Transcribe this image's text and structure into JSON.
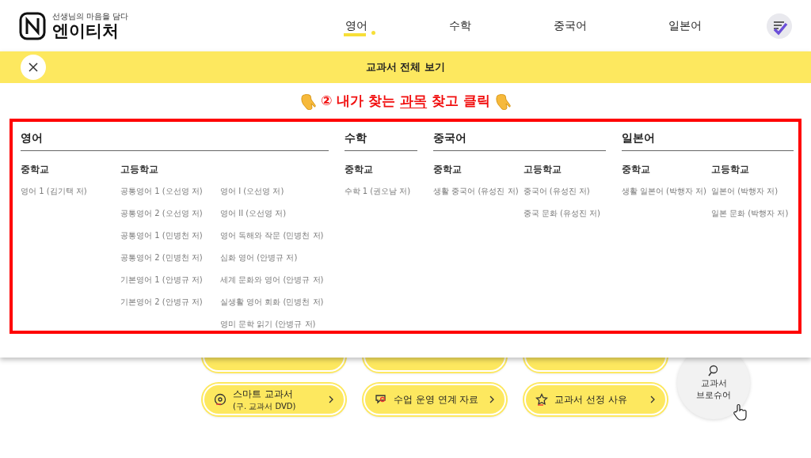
{
  "header": {
    "tagline": "선생님의 마음을 담다",
    "logo": "엔이티처",
    "nav": [
      {
        "label": "영어",
        "selected": true
      },
      {
        "label": "수학",
        "selected": false
      },
      {
        "label": "중국어",
        "selected": false
      },
      {
        "label": "일본어",
        "selected": false
      }
    ]
  },
  "banner": {
    "title": "교과서 전체 보기"
  },
  "instruction": {
    "before": "② 내가 찾는",
    "underlined": "과목",
    "after": "찾고 클릭"
  },
  "subjects": [
    {
      "title": "영어",
      "groups": [
        {
          "heading": "중학교",
          "columns": [
            [
              "영어 1 (김기택 저)"
            ]
          ]
        },
        {
          "heading": "고등학교",
          "columns": [
            [
              "공통영어 1 (오선영 저)",
              "공통영어 2 (오선영 저)",
              "공통영어 1 (민병천 저)",
              "공통영어 2 (민병천 저)",
              "기본영어 1 (안병규 저)",
              "기본영어 2 (안병규 저)"
            ],
            [
              "영어 I (오선영 저)",
              "영어 II (오선영 저)",
              "영어 독해와 작문 (민병천 저)",
              "심화 영어 (안병규 저)",
              "세계 문화와 영어 (안병규 저)",
              "실생활 영어 회화 (민병천 저)",
              "영미 문학 읽기 (안병규 저)"
            ]
          ]
        }
      ]
    },
    {
      "title": "수학",
      "groups": [
        {
          "heading": "중학교",
          "columns": [
            [
              "수학 1 (권오남 저)"
            ]
          ]
        }
      ]
    },
    {
      "title": "중국어",
      "groups": [
        {
          "heading": "중학교",
          "columns": [
            [
              "생활 중국어 (유성진 저)"
            ]
          ]
        },
        {
          "heading": "고등학교",
          "columns": [
            [
              "중국어 (유성진 저)",
              "중국 문화 (유성진 저)"
            ]
          ]
        }
      ]
    },
    {
      "title": "일본어",
      "groups": [
        {
          "heading": "중학교",
          "columns": [
            [
              "생활 일본어 (박행자 저)"
            ]
          ]
        },
        {
          "heading": "고등학교",
          "columns": [
            [
              "일본어 (박행자 저)",
              "일본 문화 (박행자 저)"
            ]
          ]
        }
      ]
    }
  ],
  "quick_links": [
    {
      "label": "스마트 교과서",
      "sublabel": "(구. 교과서 DVD)"
    },
    {
      "label": "수업 운영 연계 자료"
    },
    {
      "label": "교과서 선정 사유"
    }
  ],
  "brochure": {
    "label": "교과서 브로슈어"
  }
}
